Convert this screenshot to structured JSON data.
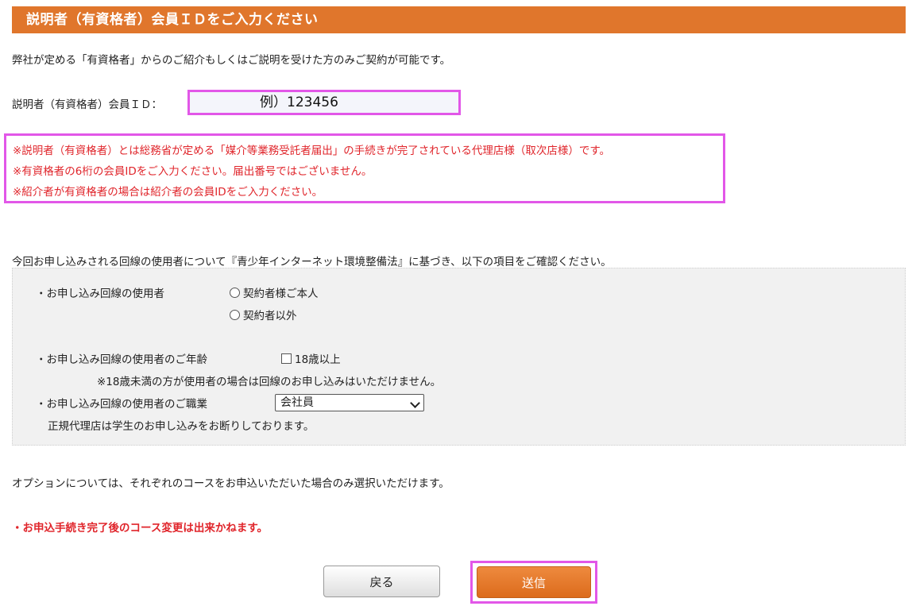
{
  "header": {
    "title": "説明者（有資格者）会員ＩＤをご入力ください"
  },
  "intro": {
    "text": "弊社が定める「有資格者」からのご紹介もしくはご説明を受けた方のみご契約が可能です。"
  },
  "member_id": {
    "label": "説明者（有資格者）会員ＩＤ：",
    "placeholder": "例）123456",
    "value": ""
  },
  "notes": [
    "※説明者（有資格者）とは総務省が定める「媒介等業務受託者届出」の手続きが完了されている代理店様（取次店様）です。",
    "※有資格者の6桁の会員IDをご入力ください。届出番号ではございません。",
    "※紹介者が有資格者の場合は紹介者の会員IDをご入力ください。"
  ],
  "youth": {
    "intro": "今回お申し込みされる回線の使用者について『青少年インターネット環境整備法』に基づき、以下の項目をご確認ください。",
    "user_label": "・お申し込み回線の使用者",
    "user_options": [
      "契約者様ご本人",
      "契約者以外"
    ],
    "age_label": "・お申し込み回線の使用者のご年齢",
    "age_checkbox": "18歳以上",
    "age_note": "※18歳未満の方が使用者の場合は回線のお申し込みはいただけません。",
    "job_label": "・お申し込み回線の使用者のご職業",
    "job_selected": "会社員",
    "job_note": "正規代理店は学生のお申し込みをお断りしております。"
  },
  "options_note": "オプションについては、それぞれのコースをお申込いただいた場合のみ選択いただけます。",
  "warning": "・お申込手続き完了後のコース変更は出来かねます。",
  "buttons": {
    "back": "戻る",
    "submit": "送信"
  },
  "colors": {
    "accent": "#e0762c",
    "warning": "#e0252b",
    "highlight": "#e257e8"
  }
}
